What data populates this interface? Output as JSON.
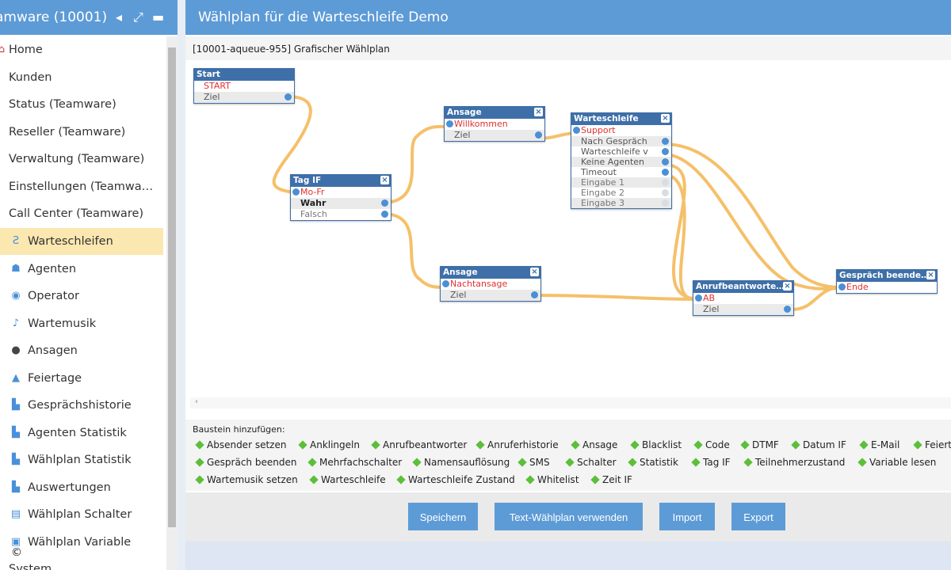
{
  "sidebar": {
    "title": "amware (10001)",
    "items": [
      {
        "label": "Home",
        "icon": "home-icon"
      },
      {
        "label": "Kunden",
        "icon": "customers-icon"
      },
      {
        "label": "Status (Teamware)",
        "icon": "status-icon"
      },
      {
        "label": "Reseller (Teamware)",
        "icon": "reseller-icon"
      },
      {
        "label": "Verwaltung (Teamware)",
        "icon": "admin-icon"
      },
      {
        "label": "Einstellungen (Teamwa…",
        "icon": "settings-icon"
      },
      {
        "label": "Call Center (Teamware)",
        "icon": "callcenter-icon"
      },
      {
        "label": "Warteschleifen",
        "icon": "queue-icon"
      },
      {
        "label": "Agenten",
        "icon": "agent-icon"
      },
      {
        "label": "Operator",
        "icon": "operator-icon"
      },
      {
        "label": "Wartemusik",
        "icon": "music-icon"
      },
      {
        "label": "Ansagen",
        "icon": "microphone-icon"
      },
      {
        "label": "Feiertage",
        "icon": "holiday-icon"
      },
      {
        "label": "Gesprächshistorie",
        "icon": "chart-icon"
      },
      {
        "label": "Agenten Statistik",
        "icon": "chart-icon"
      },
      {
        "label": "Wählplan Statistik",
        "icon": "chart-icon"
      },
      {
        "label": "Auswertungen",
        "icon": "chart-icon"
      },
      {
        "label": "Wählplan Schalter",
        "icon": "switch-icon"
      },
      {
        "label": "Wählplan Variable",
        "icon": "variable-icon"
      },
      {
        "label": "System",
        "icon": "system-icon"
      }
    ],
    "active_item": "Warteschleifen"
  },
  "main": {
    "title": "Wählplan für die Warteschleife Demo",
    "subtitle": "[10001-aqueue-955] Grafischer Wählplan",
    "scroll_left_glyph": "‹"
  },
  "nodes": {
    "start": {
      "title": "Start",
      "input": "START",
      "output": "Ziel"
    },
    "tagif": {
      "title": "Tag IF",
      "input": "Mo-Fr",
      "out1": "Wahr",
      "out2": "Falsch"
    },
    "ansage1": {
      "title": "Ansage",
      "input": "Willkommen",
      "output": "Ziel"
    },
    "ansage2": {
      "title": "Ansage",
      "input": "Nachtansage",
      "output": "Ziel"
    },
    "warteschleife": {
      "title": "Warteschleife",
      "input": "Support",
      "outputs": [
        "Nach Gespräch",
        "Warteschleife v",
        "Keine Agenten",
        "Timeout",
        "Eingabe 1",
        "Eingabe 2",
        "Eingabe 3"
      ]
    },
    "anrufbeantworter": {
      "title": "Anrufbeantworte…",
      "input": "AB",
      "output": "Ziel"
    },
    "ende": {
      "title": "Gespräch beende…",
      "input": "Ende"
    }
  },
  "palette": {
    "title": "Baustein hinzufügen:",
    "rows": [
      [
        "Absender setzen",
        "Anklingeln",
        "Anrufbeantworter",
        "Anruferhistorie",
        "Ansage",
        "Blacklist",
        "Code",
        "DTMF",
        "Datum IF",
        "E-Mail",
        "Feiert"
      ],
      [
        "Gespräch beenden",
        "Mehrfachschalter",
        "Namensauflösung",
        "SMS",
        "Schalter",
        "Statistik",
        "Tag IF",
        "Teilnehmerzustand",
        "Variable lesen"
      ],
      [
        "Wartemusik setzen",
        "Warteschleife",
        "Warteschleife Zustand",
        "Whitelist",
        "Zeit IF"
      ]
    ]
  },
  "buttons": {
    "save": "Speichern",
    "text_plan": "Text-Wählplan verwenden",
    "import": "Import",
    "export": "Export"
  },
  "footer": {
    "copyright": "©"
  },
  "colors": {
    "header_blue": "#5d9bd6",
    "node_blue": "#3e6fa8",
    "connector": "#f5c06a",
    "active_item": "#fbe7b0",
    "palette_diamond": "#5cbf3a",
    "input_red": "#e03030"
  }
}
